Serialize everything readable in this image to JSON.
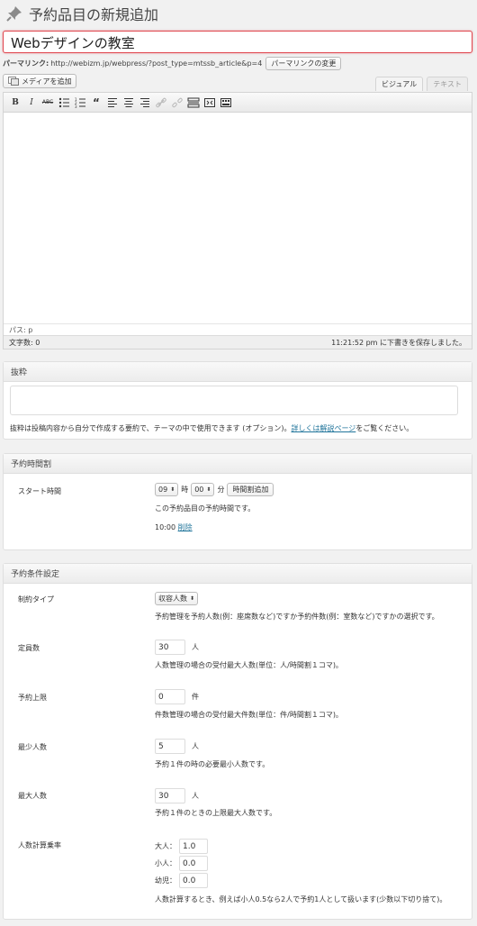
{
  "header": {
    "title": "予約品目の新規追加",
    "icon": "pin-icon"
  },
  "post_title": {
    "value": "Webデザインの教室"
  },
  "permalink": {
    "label": "パーマリンク:",
    "url": "http://webizm.jp/webpress/?post_type=mtssb_article&p=4",
    "change_button": "パーマリンクの変更"
  },
  "media": {
    "button": "メディアを追加",
    "icon": "media-icon"
  },
  "editor": {
    "tabs": [
      {
        "label": "ビジュアル",
        "active": true
      },
      {
        "label": "テキスト",
        "active": false
      }
    ],
    "toolbar": [
      "bold-icon",
      "italic-icon",
      "strikethrough-icon",
      "bullet-list-icon",
      "numbered-list-icon",
      "blockquote-icon",
      "align-left-icon",
      "align-center-icon",
      "align-right-icon",
      "link-icon",
      "unlink-icon",
      "more-tag-icon",
      "fullscreen-icon",
      "kitchen-sink-icon"
    ],
    "path": "パス: p",
    "word_count": "文字数: 0",
    "autosave": "11:21:52 pm に下書きを保存しました。"
  },
  "excerpt": {
    "title": "抜粋",
    "help_prefix": "抜粋は投稿内容から自分で作成する要約で、テーマの中で使用できます (オプション)。",
    "help_link": "詳しくは解説ページ",
    "help_suffix": "をご覧ください。"
  },
  "schedule": {
    "title": "予約時間割",
    "start_label": "スタート時間",
    "hour": "09",
    "hour_unit": "時",
    "minute": "00",
    "minute_unit": "分",
    "add_button": "時間割追加",
    "desc": "この予約品目の予約時間です。",
    "entry_time": "10:00",
    "entry_delete": "削除"
  },
  "conditions": {
    "title": "予約条件設定",
    "limit_type": {
      "label": "制約タイプ",
      "value": "収容人数",
      "desc": "予約管理を予約人数(例：座席数など)ですか予約件数(例：室数など)ですかの選択です。"
    },
    "capacity": {
      "label": "定員数",
      "value": "30",
      "unit": "人",
      "desc": "人数管理の場合の受付最大人数(単位：人/時間割１コマ)。"
    },
    "max_bookings": {
      "label": "予約上限",
      "value": "0",
      "unit": "件",
      "desc": "件数管理の場合の受付最大件数(単位：件/時間割１コマ)。"
    },
    "min_people": {
      "label": "最少人数",
      "value": "5",
      "unit": "人",
      "desc": "予約１件の時の必要最小人数です。"
    },
    "max_people": {
      "label": "最大人数",
      "value": "30",
      "unit": "人",
      "desc": "予約１件のときの上限最大人数です。"
    },
    "rate": {
      "label": "人数計算乗率",
      "adult_label": "大人：",
      "adult": "1.0",
      "child_label": "小人：",
      "child": "0.0",
      "infant_label": "幼児：",
      "infant": "0.0",
      "desc": "人数計算するとき、例えば小人0.5なら2人で予約1人として扱います(少数以下切り捨て)。"
    }
  }
}
